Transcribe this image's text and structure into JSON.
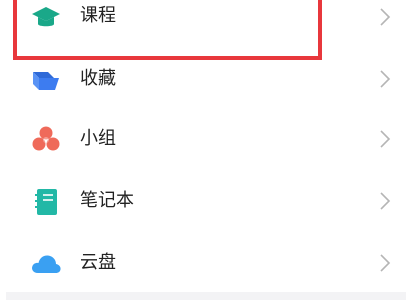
{
  "menu": {
    "items": [
      {
        "label": "课程",
        "icon": "graduation-cap-icon",
        "color": "#1aa889"
      },
      {
        "label": "收藏",
        "icon": "folder-icon",
        "color": "#3d7cf0"
      },
      {
        "label": "小组",
        "icon": "group-icon",
        "color": "#ef6a5a"
      },
      {
        "label": "笔记本",
        "icon": "notebook-icon",
        "color": "#22b8a6"
      },
      {
        "label": "云盘",
        "icon": "cloud-icon",
        "color": "#3aa0f2"
      }
    ]
  },
  "highlight": {
    "target": "课程",
    "color": "#e8373c"
  }
}
